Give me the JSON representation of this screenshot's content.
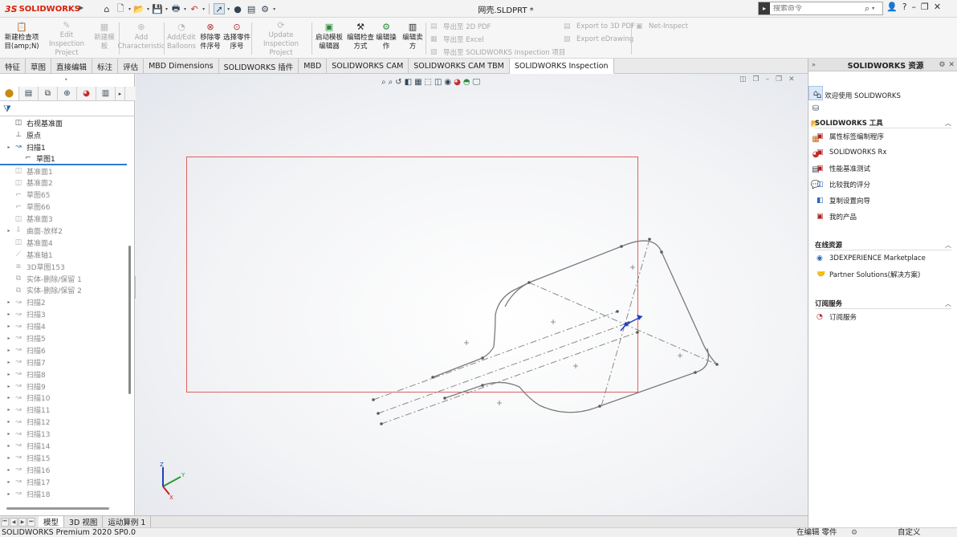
{
  "title_bar": {
    "brand": "SOLIDWORKS",
    "brand_prefix": "3S",
    "document": "网壳.SLDPRT *",
    "search_placeholder": "搜索命令",
    "help": "?"
  },
  "ribbon": {
    "buttons": [
      {
        "label": "新建检查项目(amp;N)",
        "enabled": true
      },
      {
        "label": "Edit Inspection Project",
        "enabled": false
      },
      {
        "label": "新建模板",
        "enabled": false
      },
      {
        "label": "Add Characteristic",
        "enabled": false
      },
      {
        "label": "Add/Edit Balloons",
        "enabled": false
      },
      {
        "label": "移除零件序号",
        "enabled": true
      },
      {
        "label": "选择零件序号",
        "enabled": true
      },
      {
        "label": "Update Inspection Project",
        "enabled": false
      },
      {
        "label": "启动模板编辑器",
        "enabled": true
      },
      {
        "label": "编辑检查方式",
        "enabled": true
      },
      {
        "label": "编辑操作",
        "enabled": true
      },
      {
        "label": "编辑卖方",
        "enabled": true
      }
    ],
    "export_items": [
      "导出至 2D PDF",
      "导出至 Excel",
      "导出至 SOLIDWORKS Inspection 项目"
    ],
    "export_items_2": [
      "Export to 3D PDF",
      "Export eDrawing"
    ],
    "net_inspect": "Net-Inspect"
  },
  "tabs": [
    {
      "label": "特征",
      "active": false
    },
    {
      "label": "草图",
      "active": false
    },
    {
      "label": "直接编辑",
      "active": false
    },
    {
      "label": "标注",
      "active": false
    },
    {
      "label": "评估",
      "active": false
    },
    {
      "label": "MBD Dimensions",
      "active": false
    },
    {
      "label": "SOLIDWORKS 插件",
      "active": false
    },
    {
      "label": "MBD",
      "active": false
    },
    {
      "label": "SOLIDWORKS CAM",
      "active": false
    },
    {
      "label": "SOLIDWORKS CAM TBM",
      "active": false
    },
    {
      "label": "SOLIDWORKS Inspection",
      "active": true
    }
  ],
  "feature_tree": {
    "items": [
      {
        "label": "右视基准面",
        "icon": "plane-icon",
        "expand": false,
        "grey": false,
        "indent": 0
      },
      {
        "label": "原点",
        "icon": "origin-icon",
        "expand": false,
        "grey": false,
        "indent": 0
      },
      {
        "label": "扫描1",
        "icon": "sweep-icon",
        "expand": true,
        "grey": false,
        "indent": 0
      },
      {
        "label": "草图1",
        "icon": "sketch-icon",
        "expand": false,
        "grey": false,
        "indent": 1,
        "selected": true
      },
      {
        "label": "基准面1",
        "icon": "plane-icon",
        "expand": false,
        "grey": true,
        "indent": 0
      },
      {
        "label": "基准面2",
        "icon": "plane-icon",
        "expand": false,
        "grey": true,
        "indent": 0
      },
      {
        "label": "草图65",
        "icon": "sketch-icon",
        "expand": false,
        "grey": true,
        "indent": 0
      },
      {
        "label": "草图66",
        "icon": "sketch-icon",
        "expand": false,
        "grey": true,
        "indent": 0
      },
      {
        "label": "基准面3",
        "icon": "plane-icon",
        "expand": false,
        "grey": true,
        "indent": 0
      },
      {
        "label": "曲面-放样2",
        "icon": "loft-icon",
        "expand": true,
        "grey": true,
        "indent": 0
      },
      {
        "label": "基准面4",
        "icon": "plane-icon",
        "expand": false,
        "grey": true,
        "indent": 0
      },
      {
        "label": "基准轴1",
        "icon": "axis-icon",
        "expand": false,
        "grey": true,
        "indent": 0
      },
      {
        "label": "3D草图153",
        "icon": "sketch3d-icon",
        "expand": false,
        "grey": true,
        "indent": 0
      },
      {
        "label": "实体-删除/保留 1",
        "icon": "body-delete-icon",
        "expand": false,
        "grey": true,
        "indent": 0
      },
      {
        "label": "实体-删除/保留 2",
        "icon": "body-delete-icon",
        "expand": false,
        "grey": true,
        "indent": 0
      },
      {
        "label": "扫描2",
        "icon": "sweep-icon",
        "expand": true,
        "grey": true,
        "indent": 0
      },
      {
        "label": "扫描3",
        "icon": "sweep-icon",
        "expand": true,
        "grey": true,
        "indent": 0
      },
      {
        "label": "扫描4",
        "icon": "sweep-icon",
        "expand": true,
        "grey": true,
        "indent": 0
      },
      {
        "label": "扫描5",
        "icon": "sweep-icon",
        "expand": true,
        "grey": true,
        "indent": 0
      },
      {
        "label": "扫描6",
        "icon": "sweep-icon",
        "expand": true,
        "grey": true,
        "indent": 0
      },
      {
        "label": "扫描7",
        "icon": "sweep-icon",
        "expand": true,
        "grey": true,
        "indent": 0
      },
      {
        "label": "扫描8",
        "icon": "sweep-icon",
        "expand": true,
        "grey": true,
        "indent": 0
      },
      {
        "label": "扫描9",
        "icon": "sweep-icon",
        "expand": true,
        "grey": true,
        "indent": 0
      },
      {
        "label": "扫描10",
        "icon": "sweep-icon",
        "expand": true,
        "grey": true,
        "indent": 0
      },
      {
        "label": "扫描11",
        "icon": "sweep-icon",
        "expand": true,
        "grey": true,
        "indent": 0
      },
      {
        "label": "扫描12",
        "icon": "sweep-icon",
        "expand": true,
        "grey": true,
        "indent": 0
      },
      {
        "label": "扫描13",
        "icon": "sweep-icon",
        "expand": true,
        "grey": true,
        "indent": 0
      },
      {
        "label": "扫描14",
        "icon": "sweep-icon",
        "expand": true,
        "grey": true,
        "indent": 0
      },
      {
        "label": "扫描15",
        "icon": "sweep-icon",
        "expand": true,
        "grey": true,
        "indent": 0
      },
      {
        "label": "扫描16",
        "icon": "sweep-icon",
        "expand": true,
        "grey": true,
        "indent": 0
      },
      {
        "label": "扫描17",
        "icon": "sweep-icon",
        "expand": true,
        "grey": true,
        "indent": 0
      },
      {
        "label": "扫描18",
        "icon": "sweep-icon",
        "expand": true,
        "grey": true,
        "indent": 0
      }
    ]
  },
  "bottom_tabs": [
    {
      "label": "模型",
      "active": true
    },
    {
      "label": "3D 视图",
      "active": false
    },
    {
      "label": "运动算例 1",
      "active": false
    }
  ],
  "status_bar": {
    "product": "SOLIDWORKS Premium 2020 SP0.0",
    "mode": "在编辑 零件",
    "units": "自定义"
  },
  "right_pane": {
    "title": "SOLIDWORKS 资源",
    "welcome": "欢迎使用  SOLIDWORKS",
    "sections": [
      {
        "title": "SOLIDWORKS 工具",
        "items": [
          "属性标签编制程序",
          "SOLIDWORKS Rx",
          "性能基准测试",
          "比较我的评分",
          "复制设置向导",
          "我的产品"
        ]
      },
      {
        "title": "在线资源",
        "items": [
          "3DEXPERIENCE Marketplace",
          "Partner Solutions(解决方案)"
        ]
      },
      {
        "title": "订阅服务",
        "items": [
          "订阅服务"
        ]
      }
    ]
  },
  "colors": {
    "brand_red": "#d81e05",
    "sketch_box": "#e06060",
    "selection_blue": "#2b7cd3",
    "axis_x": "#c8202a",
    "axis_y": "#2a9a3a",
    "axis_z": "#2040c0"
  },
  "triad_labels": {
    "x": "X",
    "y": "Y",
    "z": "Z"
  }
}
